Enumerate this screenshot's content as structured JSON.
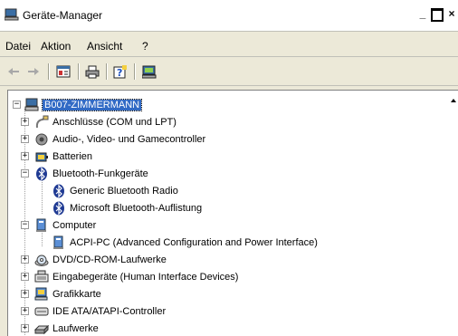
{
  "window": {
    "title": "Geräte-Manager",
    "minimize": "_",
    "close": "×"
  },
  "menu": [
    {
      "label": "Datei"
    },
    {
      "label": "Aktion"
    },
    {
      "label": "Ansicht"
    },
    {
      "label": "?"
    }
  ],
  "toolbar": {
    "back_icon": "arrow-left",
    "forward_icon": "arrow-right",
    "properties_icon": "properties",
    "print_icon": "printer",
    "help_icon": "help",
    "scan_icon": "scan-hardware"
  },
  "tree": {
    "root": "B007-ZIMMERMANN",
    "items": [
      {
        "label": "Anschlüsse (COM und LPT)",
        "icon": "port",
        "expander": "+"
      },
      {
        "label": "Audio-, Video- und Gamecontroller",
        "icon": "audio",
        "expander": "+"
      },
      {
        "label": "Batterien",
        "icon": "battery",
        "expander": "+"
      },
      {
        "label": "Bluetooth-Funkgeräte",
        "icon": "bluetooth",
        "expander": "−"
      },
      {
        "label": "Generic Bluetooth Radio",
        "icon": "bluetooth",
        "child": true
      },
      {
        "label": "Microsoft Bluetooth-Auflistung",
        "icon": "bluetooth",
        "child": true
      },
      {
        "label": "Computer",
        "icon": "computer",
        "expander": "−"
      },
      {
        "label": "ACPI-PC (Advanced Configuration and Power Interface)",
        "icon": "computer",
        "child": true
      },
      {
        "label": "DVD/CD-ROM-Laufwerke",
        "icon": "cdrom",
        "expander": "+"
      },
      {
        "label": "Eingabegeräte (Human Interface Devices)",
        "icon": "keyboard",
        "expander": "+"
      },
      {
        "label": "Grafikkarte",
        "icon": "display",
        "expander": "+"
      },
      {
        "label": "IDE ATA/ATAPI-Controller",
        "icon": "ide",
        "expander": "+"
      },
      {
        "label": "Laufwerke",
        "icon": "drive",
        "expander": "+"
      }
    ]
  }
}
